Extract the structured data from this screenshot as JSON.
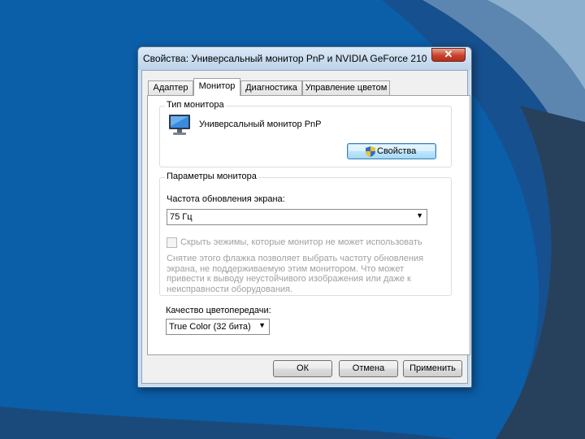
{
  "window": {
    "title": "Свойства: Универсальный монитор PnP и NVIDIA GeForce 210",
    "close_glyph": "✕"
  },
  "tabs": [
    {
      "label": "Адаптер",
      "active": false
    },
    {
      "label": "Монитор",
      "active": true
    },
    {
      "label": "Диагностика",
      "active": false
    },
    {
      "label": "Управление цветом",
      "active": false
    }
  ],
  "monitor_type": {
    "group_title": "Тип монитора",
    "monitor_name": "Универсальный монитор PnP",
    "properties_button": "Свойства",
    "icon": "monitor-icon",
    "shield_icon": "shield-icon"
  },
  "monitor_settings": {
    "group_title": "Параметры монитора",
    "refresh_label": "Частота обновления экрана:",
    "refresh_value": "75 Гц",
    "hide_modes_label": "Скрыть эежимы, которые монитор не может использовать",
    "hide_modes_checked": false,
    "description": "Снятие этого флажка позволяет выбрать частоту обновления экрана, не поддерживаемую этим монитором. Что может привести к выводу неустойчивого изображения или даже к неисправности оборудования."
  },
  "color": {
    "label": "Качество цветопередачи:",
    "value": "True Color (32 бита)"
  },
  "footer": {
    "ok": "ОК",
    "cancel": "Отмена",
    "apply": "Применить"
  },
  "colors": {
    "desktop": "#0b5ea8",
    "accent": "#3c7fb1"
  }
}
